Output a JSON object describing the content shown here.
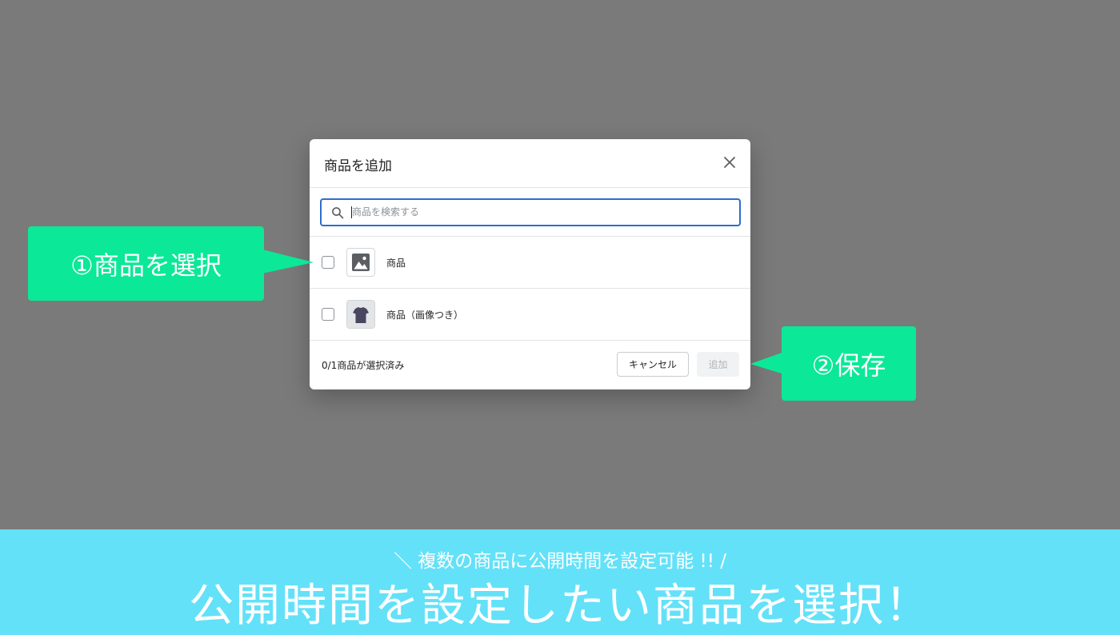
{
  "modal": {
    "title": "商品を追加",
    "search": {
      "placeholder": "商品を検索する",
      "value": ""
    },
    "products": [
      {
        "label": "商品",
        "thumbnail": "image-placeholder-icon"
      },
      {
        "label": "商品（画像つき）",
        "thumbnail": "tshirt-thumbnail"
      }
    ],
    "footer": {
      "selected_count": "0/1商品が選択済み",
      "cancel_label": "キャンセル",
      "add_label": "追加"
    }
  },
  "callouts": {
    "step1": "①商品を選択",
    "step2": "②保存"
  },
  "banner": {
    "subtitle": "＼ 複数の商品に公開時間を設定可能 !! /",
    "title": "公開時間を設定したい商品を選択！"
  },
  "colors": {
    "overlay": "#7a7a7a",
    "callout": "#0be897",
    "banner": "#63e1f8",
    "focus": "#2c6ecb"
  }
}
